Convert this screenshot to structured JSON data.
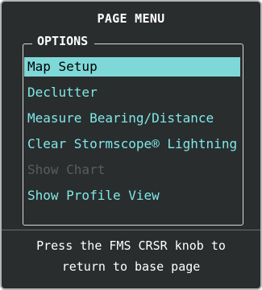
{
  "title": "PAGE MENU",
  "options_label": "OPTIONS",
  "menu": {
    "items": [
      {
        "label": "Map Setup",
        "state": "selected"
      },
      {
        "label": "Declutter",
        "state": "enabled"
      },
      {
        "label": "Measure Bearing/Distance",
        "state": "enabled"
      },
      {
        "label": "Clear Stormscope® Lightning",
        "state": "enabled"
      },
      {
        "label": "Show Chart",
        "state": "disabled"
      },
      {
        "label": "Show Profile View",
        "state": "enabled"
      }
    ]
  },
  "footer": {
    "line1": "Press the FMS CRSR knob to",
    "line2": "return to base page"
  },
  "colors": {
    "background": "#2a2d2e",
    "item_text": "#7fe8e8",
    "selected_bg": "#7fd8d8",
    "disabled_text": "#5a5d5f"
  }
}
